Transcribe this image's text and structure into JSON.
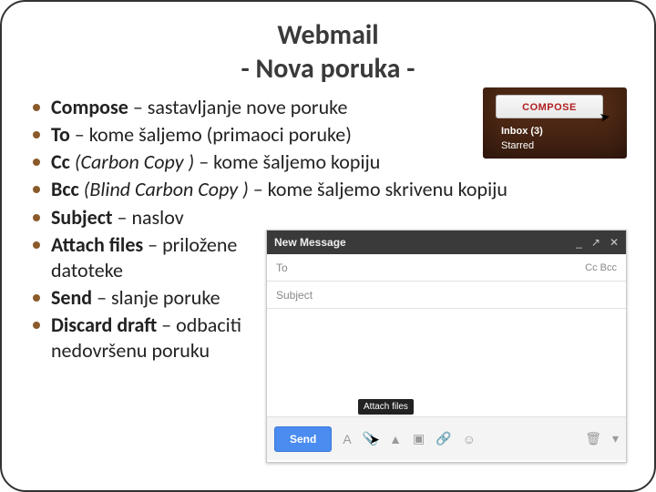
{
  "title": {
    "line1": "Webmail",
    "line2": "- Nova poruka -"
  },
  "bullets": [
    {
      "term": "Compose",
      "italic_after": "",
      "rest": " – sastavljanje nove poruke"
    },
    {
      "term": "To",
      "italic_after": "",
      "rest": " – kome šaljemo (primaoci poruke)"
    },
    {
      "term": "Cc",
      "italic_after": " (Carbon Copy )",
      "rest": " – kome šaljemo kopiju"
    },
    {
      "term": "Bcc",
      "italic_after": " (Blind Carbon Copy )",
      "rest": " – kome šaljemo skrivenu kopiju"
    },
    {
      "term": "Subject",
      "italic_after": "",
      "rest": " – naslov"
    },
    {
      "term": "Attach files",
      "italic_after": "",
      "rest": " – priložene datoteke"
    },
    {
      "term": "Send",
      "italic_after": "",
      "rest": " – slanje poruke"
    },
    {
      "term": "Discard draft",
      "italic_after": "",
      "rest": " – odbaciti nedovršenu poruku"
    }
  ],
  "inset_compose": {
    "button": "COMPOSE",
    "inbox": "Inbox (3)",
    "starred": "Starred"
  },
  "inset_msg": {
    "title": "New Message",
    "win": {
      "min": "_",
      "pop": "↗",
      "close": "✕"
    },
    "to": "To",
    "ccbcc": "Cc  Bcc",
    "subject": "Subject",
    "send": "Send",
    "tooltip": "Attach files",
    "icons": {
      "font": "A",
      "clip": "📎",
      "drive": "▲",
      "photo": "▣",
      "link": "🔗",
      "smile": "☺",
      "more": "▾",
      "trash": "🗑"
    }
  }
}
